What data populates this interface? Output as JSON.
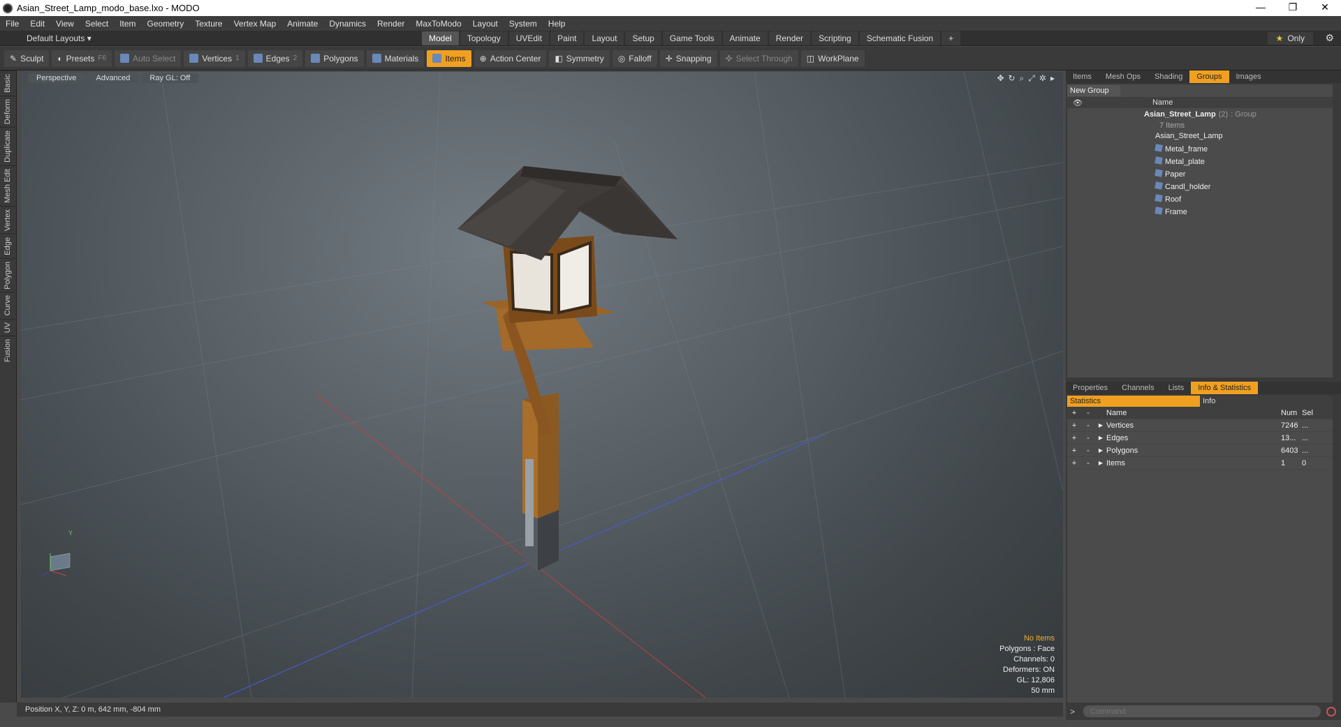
{
  "window": {
    "title": "Asian_Street_Lamp_modo_base.lxo - MODO",
    "min": "—",
    "max": "❐",
    "close": "✕"
  },
  "menu": [
    "File",
    "Edit",
    "View",
    "Select",
    "Item",
    "Geometry",
    "Texture",
    "Vertex Map",
    "Animate",
    "Dynamics",
    "Render",
    "MaxToModo",
    "Layout",
    "System",
    "Help"
  ],
  "layout": {
    "selector": "Default Layouts ▾",
    "tabs": [
      "Model",
      "Topology",
      "UVEdit",
      "Paint",
      "Layout",
      "Setup",
      "Game Tools",
      "Animate",
      "Render",
      "Scripting",
      "Schematic Fusion"
    ],
    "active_tab": "Model",
    "add": "+",
    "only_label": "Only",
    "star": "★"
  },
  "toolbar": {
    "sculpt": "Sculpt",
    "presets": "Presets",
    "presets_key": "F6",
    "auto_select": "Auto Select",
    "vertices": "Vertices",
    "vertices_count": "1",
    "edges": "Edges",
    "edges_count": "2",
    "polygons": "Polygons",
    "materials": "Materials",
    "items": "Items",
    "action_center": "Action Center",
    "symmetry": "Symmetry",
    "falloff": "Falloff",
    "snapping": "Snapping",
    "select_through": "Select Through",
    "workplane": "WorkPlane"
  },
  "left_tabs": [
    "Basic",
    "Deform",
    "Duplicate",
    "Mesh Edit",
    "Vertex",
    "Edge",
    "Polygon",
    "Curve",
    "UV",
    "Fusion"
  ],
  "viewport": {
    "view_mode": "Perspective",
    "shading": "Advanced",
    "raygl": "Ray GL: Off",
    "info": {
      "selection": "No Items",
      "polygons": "Polygons : Face",
      "channels": "Channels: 0",
      "deformers": "Deformers: ON",
      "gl": "GL: 12,806",
      "grid": "50 mm"
    },
    "axis_y": "Y"
  },
  "status": {
    "position": "Position X, Y, Z:  0 m, 642 mm, -804 mm"
  },
  "groups_panel": {
    "tabs": [
      "Items",
      "Mesh Ops",
      "Shading",
      "Groups",
      "Images"
    ],
    "active_tab": "Groups",
    "new_group": "New Group",
    "column_name": "Name",
    "root": {
      "name": "Asian_Street_Lamp",
      "count": "(2)",
      "type": ": Group",
      "sub": "7 Items"
    },
    "children": [
      "Asian_Street_Lamp",
      "Metal_frame",
      "Metal_plate",
      "Paper",
      "Candl_holder",
      "Roof",
      "Frame"
    ]
  },
  "stats_panel": {
    "tabs": [
      "Properties",
      "Channels",
      "Lists",
      "Info & Statistics"
    ],
    "active_tab": "Info & Statistics",
    "subtabs": [
      "Statistics",
      "Info"
    ],
    "columns": {
      "name": "Name",
      "num": "Num",
      "sel": "Sel"
    },
    "rows": [
      {
        "name": "Vertices",
        "num": "7246",
        "sel": "..."
      },
      {
        "name": "Edges",
        "num": "13...",
        "sel": "..."
      },
      {
        "name": "Polygons",
        "num": "6403",
        "sel": "..."
      },
      {
        "name": "Items",
        "num": "1",
        "sel": "0"
      }
    ]
  },
  "command": {
    "prompt": ">",
    "placeholder": "Command"
  }
}
